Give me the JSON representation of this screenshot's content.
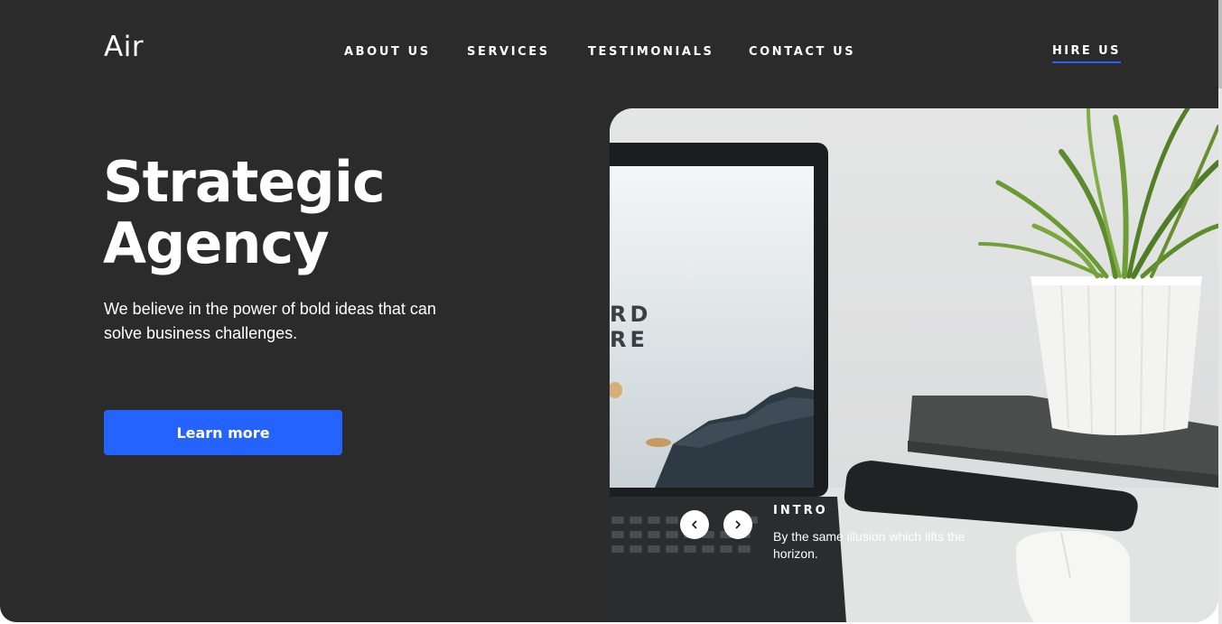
{
  "brand": {
    "logo": "Air"
  },
  "nav": {
    "items": [
      {
        "label": "ABOUT US"
      },
      {
        "label": "SERVICES"
      },
      {
        "label": "TESTIMONIALS"
      },
      {
        "label": "CONTACT US"
      }
    ],
    "hire_label": "HIRE US"
  },
  "hero": {
    "title_line1": "Strategic",
    "title_line2": "Agency",
    "subtitle": "We believe in the power of bold ideas that can solve business challenges.",
    "cta_label": "Learn more"
  },
  "slider": {
    "screen_text_line1": "RD",
    "screen_text_line2": "RE",
    "caption_label": "INTRO",
    "caption_text": "By the same illusion which lifts the horizon.",
    "prev_icon": "chevron-left-icon",
    "next_icon": "chevron-right-icon"
  },
  "colors": {
    "background": "#2b2b2b",
    "accent": "#2563ff",
    "text": "#ffffff"
  }
}
